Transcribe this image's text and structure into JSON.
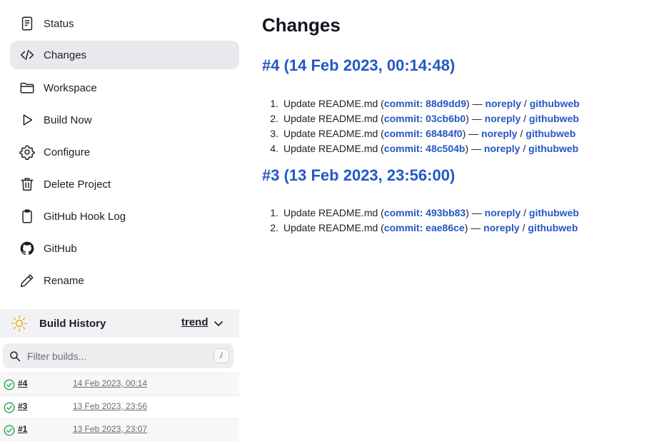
{
  "sidebar": {
    "tasks": [
      {
        "label": "Status",
        "icon": "document-icon"
      },
      {
        "label": "Changes",
        "icon": "code-icon"
      },
      {
        "label": "Workspace",
        "icon": "folder-icon"
      },
      {
        "label": "Build Now",
        "icon": "play-icon"
      },
      {
        "label": "Configure",
        "icon": "gear-icon"
      },
      {
        "label": "Delete Project",
        "icon": "trash-icon"
      },
      {
        "label": "GitHub Hook Log",
        "icon": "clipboard-icon"
      },
      {
        "label": "GitHub",
        "icon": "github-icon"
      },
      {
        "label": "Rename",
        "icon": "pencil-icon"
      }
    ]
  },
  "build_history": {
    "title": "Build History",
    "trend_label": "trend",
    "filter_placeholder": "Filter builds...",
    "filter_shortcut": "/",
    "builds": [
      {
        "number": "#4",
        "date": "14 Feb 2023, 00:14",
        "status": "success"
      },
      {
        "number": "#3",
        "date": "13 Feb 2023, 23:56",
        "status": "success"
      },
      {
        "number": "#1",
        "date": "13 Feb 2023, 23:07",
        "status": "success"
      }
    ]
  },
  "main": {
    "title": "Changes",
    "builds": [
      {
        "heading": "#4 (14 Feb 2023, 00:14:48)",
        "changes": [
          {
            "n": "1.",
            "message": "Update README.md",
            "commit": "commit: 88d9dd9",
            "author": "noreply",
            "browser": "githubweb"
          },
          {
            "n": "2.",
            "message": "Update README.md",
            "commit": "commit: 03cb6b0",
            "author": "noreply",
            "browser": "githubweb"
          },
          {
            "n": "3.",
            "message": "Update README.md",
            "commit": "commit: 68484f0",
            "author": "noreply",
            "browser": "githubweb"
          },
          {
            "n": "4.",
            "message": "Update README.md",
            "commit": "commit: 48c504b",
            "author": "noreply",
            "browser": "githubweb"
          }
        ]
      },
      {
        "heading": "#3 (13 Feb 2023, 23:56:00)",
        "changes": [
          {
            "n": "1.",
            "message": "Update README.md",
            "commit": "commit: 493bb83",
            "author": "noreply",
            "browser": "githubweb"
          },
          {
            "n": "2.",
            "message": "Update README.md",
            "commit": "commit: eae86ce",
            "author": "noreply",
            "browser": "githubweb"
          }
        ]
      }
    ]
  },
  "colors": {
    "link": "#2557c4",
    "success": "#1ea446",
    "sun": "#f0a820",
    "active_task_bg": "#e9e9ed"
  }
}
